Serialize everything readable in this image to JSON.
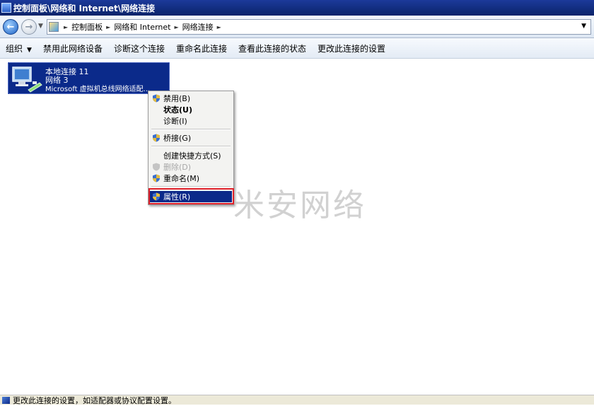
{
  "window": {
    "title": "控制面板\\网络和 Internet\\网络连接"
  },
  "address": {
    "crumbs": [
      "控制面板",
      "网络和 Internet",
      "网络连接"
    ],
    "icons": {
      "back": "back-arrow-icon",
      "forward": "forward-arrow-icon",
      "location": "control-panel-icon"
    }
  },
  "toolbar": {
    "organize": "组织",
    "disable": "禁用此网络设备",
    "diagnose": "诊断这个连接",
    "rename": "重命名此连接",
    "view_status": "查看此连接的状态",
    "change_settings": "更改此连接的设置"
  },
  "connection": {
    "name": "本地连接 11",
    "network": "网络  3",
    "adapter": "Microsoft 虚拟机总线网络适配..."
  },
  "context_menu": {
    "items": [
      {
        "label": "禁用(B)",
        "icon": "uac-shield-icon"
      },
      {
        "label": "状态(U)"
      },
      {
        "label": "诊断(I)"
      },
      {
        "label": "桥接(G)",
        "icon": "uac-shield-icon"
      },
      {
        "label": "创建快捷方式(S)"
      },
      {
        "label": "删除(D)",
        "icon": "uac-shield-icon",
        "disabled": true
      },
      {
        "label": "重命名(M)",
        "icon": "uac-shield-icon"
      },
      {
        "label": "属性(R)",
        "icon": "uac-shield-icon",
        "selected": true
      }
    ]
  },
  "watermark": {
    "text": "米安网络"
  },
  "status_bar": {
    "text": "更改此连接的设置，如适配器或协议配置设置。"
  },
  "colors": {
    "selection": "#0b2a8a",
    "highlight_box": "#e0202a",
    "title_bar": "#0a246a"
  }
}
